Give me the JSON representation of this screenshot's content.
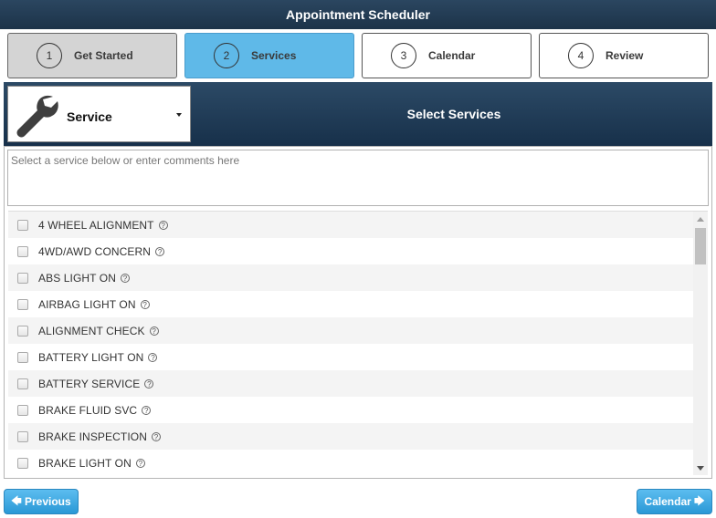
{
  "app": {
    "title": "Appointment Scheduler"
  },
  "steps": [
    {
      "num": "1",
      "label": "Get Started",
      "state": "done"
    },
    {
      "num": "2",
      "label": "Services",
      "state": "active"
    },
    {
      "num": "3",
      "label": "Calendar",
      "state": "pending"
    },
    {
      "num": "4",
      "label": "Review",
      "state": "pending"
    }
  ],
  "header": {
    "selector_label": "Service",
    "selector_icon": "wrench-icon",
    "title": "Select Services"
  },
  "comments": {
    "placeholder": "Select a service below or enter comments here",
    "value": ""
  },
  "services": [
    {
      "label": "4 WHEEL ALIGNMENT",
      "checked": false
    },
    {
      "label": "4WD/AWD CONCERN",
      "checked": false
    },
    {
      "label": "ABS LIGHT ON",
      "checked": false
    },
    {
      "label": "AIRBAG LIGHT ON",
      "checked": false
    },
    {
      "label": "ALIGNMENT CHECK",
      "checked": false
    },
    {
      "label": "BATTERY LIGHT ON",
      "checked": false
    },
    {
      "label": "BATTERY SERVICE",
      "checked": false
    },
    {
      "label": "BRAKE FLUID SVC",
      "checked": false
    },
    {
      "label": "BRAKE INSPECTION",
      "checked": false
    },
    {
      "label": "BRAKE LIGHT ON",
      "checked": false
    }
  ],
  "help_glyph": "?",
  "nav": {
    "prev_label": "Previous",
    "prev_arrow": "🡄",
    "next_label": "Calendar",
    "next_arrow": "🡆"
  },
  "colors": {
    "header_bg": "#1c3349",
    "active_step": "#5fb9e8",
    "done_step": "#d4d4d4",
    "button_blue": "#2a98d6"
  }
}
